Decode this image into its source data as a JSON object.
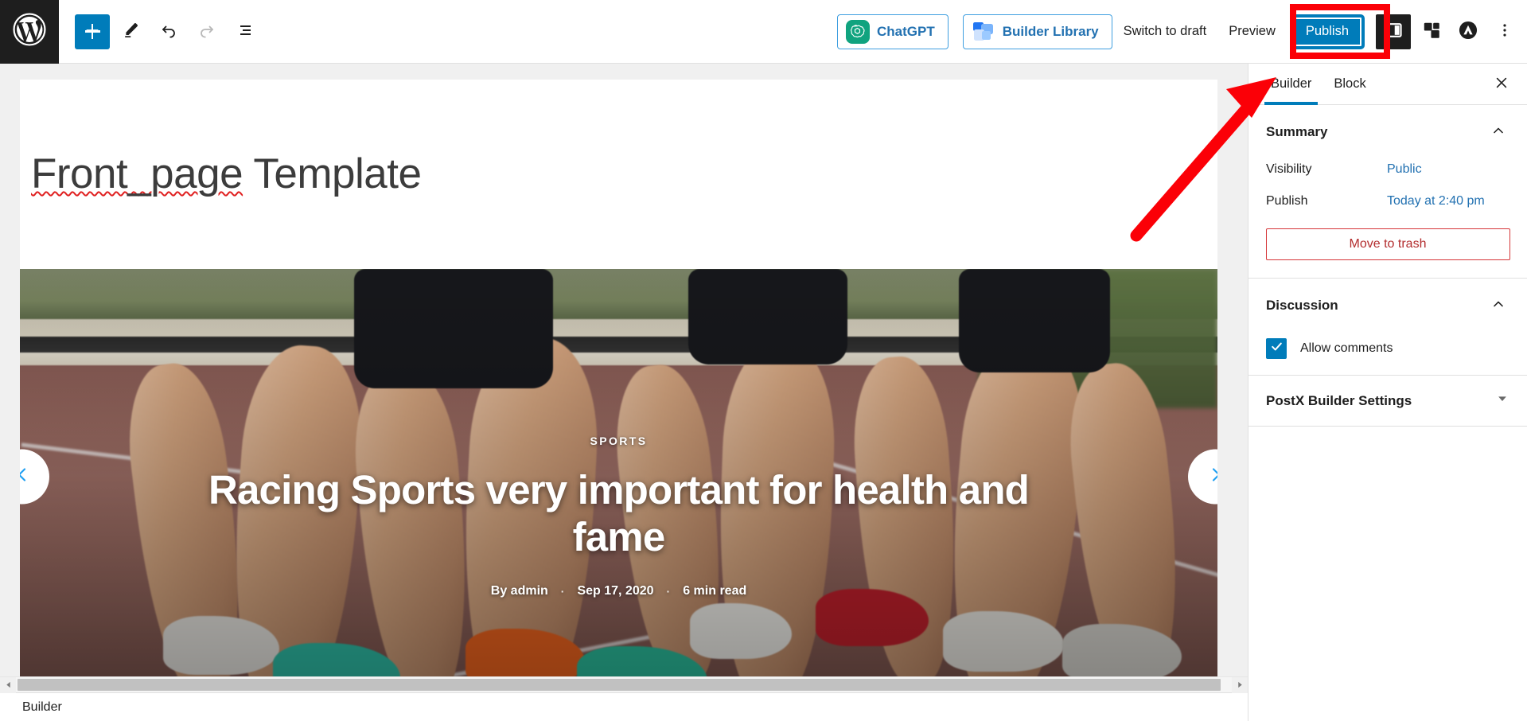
{
  "topbar": {
    "logo_icon": "wordpress-logo-icon",
    "add_block_icon": "plus-icon",
    "edit_icon": "pencil-icon",
    "undo_icon": "undo-arrow-icon",
    "redo_icon": "redo-arrow-icon",
    "list_view_icon": "document-outline-icon",
    "chatgpt_label": "ChatGPT",
    "builder_library_label": "Builder Library",
    "switch_to_draft_label": "Switch to draft",
    "preview_label": "Preview",
    "publish_label": "Publish",
    "settings_sidebar_icon": "sidebar-panel-icon",
    "blocks_icon": "blocks-stack-icon",
    "astra_icon": "astra-logo-icon",
    "options_icon": "kebab-menu-icon"
  },
  "editor": {
    "post_title": "Front_page Template",
    "post_title_misspelled_part": "Front_page",
    "post_title_rest": " Template"
  },
  "hero": {
    "category": "SPORTS",
    "headline": "Racing Sports very important for health and fame",
    "byline_author": "By  admin",
    "byline_date": "Sep 17, 2020",
    "byline_read_time": "6 min read",
    "separator": "·",
    "prev_icon": "chevron-left-icon",
    "next_icon": "chevron-right-icon"
  },
  "sidebar": {
    "tabs": [
      {
        "label": "Builder",
        "active": true
      },
      {
        "label": "Block",
        "active": false
      }
    ],
    "close_icon": "close-x-icon",
    "summary": {
      "title": "Summary",
      "collapse_icon": "chevron-up-icon",
      "rows": [
        {
          "label": "Visibility",
          "value": "Public"
        },
        {
          "label": "Publish",
          "value": "Today at 2:40 pm"
        }
      ],
      "trash_label": "Move to trash"
    },
    "discussion": {
      "title": "Discussion",
      "collapse_icon": "chevron-up-icon",
      "allow_comments_label": "Allow comments",
      "allow_comments_checked": true,
      "check_icon": "checkmark-icon"
    },
    "postx": {
      "title": "PostX Builder Settings",
      "expand_icon": "chevron-down-icon"
    }
  },
  "statusbar": {
    "breadcrumb": "Builder"
  },
  "annotation": {
    "highlight_target": "Publish",
    "highlight_color": "#fb0007",
    "arrow_icon": "red-pointer-arrow-icon"
  },
  "colors": {
    "wp_blue": "#007cba",
    "link_blue": "#2271b1",
    "dark": "#1e1e1e",
    "danger": "#b32d2e",
    "highlight_red": "#fb0007",
    "chatgpt_green": "#10a37f"
  }
}
